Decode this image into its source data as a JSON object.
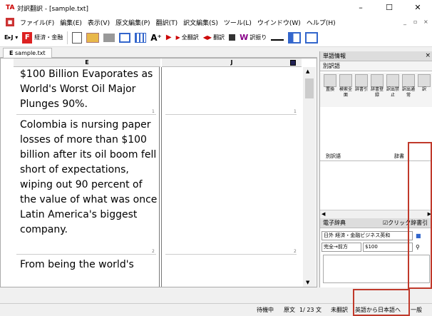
{
  "window": {
    "title": "対訳翻訳 - [sample.txt]",
    "app_icon": "TA",
    "minimize": "–",
    "maximize": "☐",
    "close": "✕"
  },
  "menubar": {
    "items": [
      "ファイル(F)",
      "編集(E)",
      "表示(V)",
      "原文編集(P)",
      "翻訳(T)",
      "訳文編集(S)",
      "ツール(L)",
      "ウインドウ(W)",
      "ヘルプ(H)"
    ]
  },
  "toolbar": {
    "lang_label": "E▸J ▾",
    "domain_label": "経済・金融",
    "translate_all": "全翻訳",
    "translate": "翻訳",
    "dict_lookup": "訳振り"
  },
  "doc_tab": {
    "label": "sample.txt",
    "icon": "E"
  },
  "editor": {
    "col_source": "E",
    "col_target": "J",
    "segments": [
      {
        "text": "$100 Billion Evaporates as World's Worst Oil Major Plunges 90%.",
        "num": "1"
      },
      {
        "text": "Colombia is nursing paper losses of more than $100 billion after its oil boom fell short of expectations, wiping out 90 percent of the value of what was once Latin America's biggest company.",
        "num": "2"
      },
      {
        "text": "From being the world's",
        "num": ""
      }
    ]
  },
  "right_panel": {
    "title": "単語情報",
    "sub_title": "別訳語",
    "tools": [
      "置換",
      "検索全面",
      "辞書引",
      "辞書登録",
      "訳出禁止",
      "訳出通常",
      "訳"
    ],
    "list_header_left": "別訳語",
    "list_header_right": "辞書",
    "edict_title": "電子辞典",
    "edict_check": "クリック辞書引",
    "dict_select": "日外 経済・金融ビジネス英和",
    "mode_select": "完全→前方",
    "search_value": "$100"
  },
  "status": {
    "state": "待機中",
    "source_label": "原文",
    "count": "1/ 23 文",
    "untranslated": "未翻訳",
    "direction": "英語から日本語へ",
    "general": "一般"
  },
  "colors": {
    "accent_red": "#c0392b",
    "brand_red": "#d22"
  }
}
